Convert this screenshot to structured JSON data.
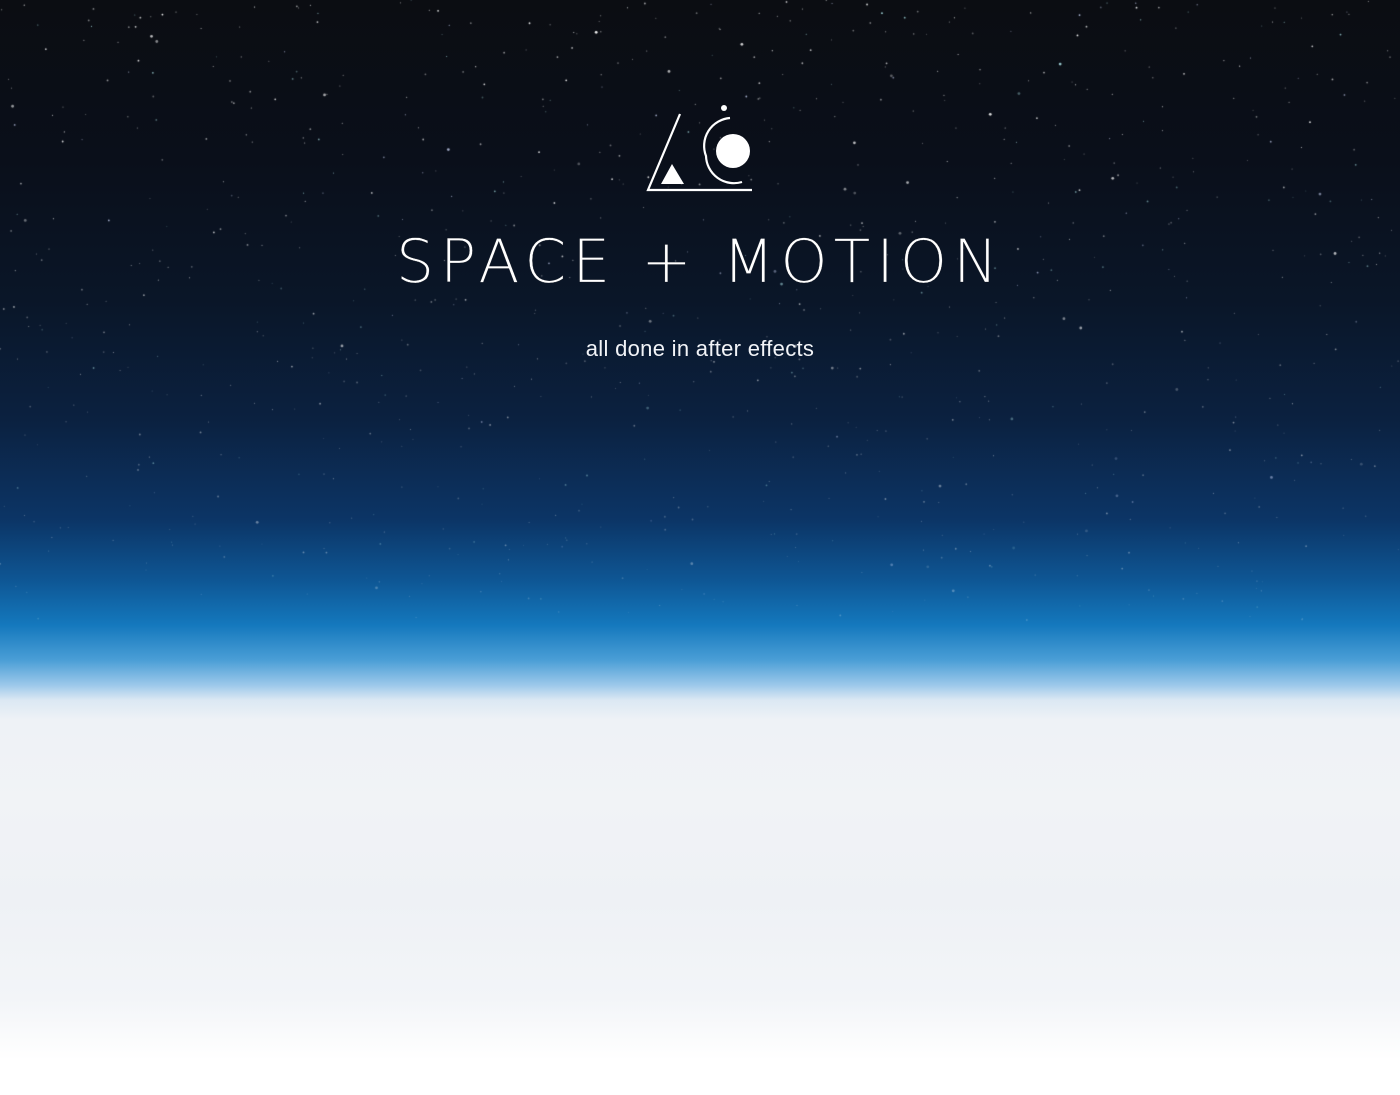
{
  "hero": {
    "title": "SPACE + MOTION",
    "subtitle": "all done in after effects",
    "logo_icon": "triangle-circle-orbit-logo-icon"
  },
  "colors": {
    "space": "#0b0d12",
    "atmosphere": "#1478bd",
    "clouds": "#eef1f5",
    "text": "#ffffff"
  }
}
